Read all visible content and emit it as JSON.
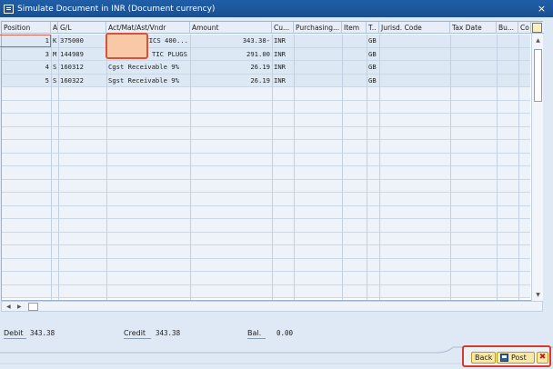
{
  "window": {
    "title": "Simulate Document in INR (Document currency)",
    "close_glyph": "×"
  },
  "columns": [
    {
      "key": "position",
      "label": "Position"
    },
    {
      "key": "a",
      "label": "A"
    },
    {
      "key": "gl",
      "label": "G/L"
    },
    {
      "key": "act",
      "label": "Act/Mat/Ast/Vndr"
    },
    {
      "key": "amount",
      "label": "Amount"
    },
    {
      "key": "cu",
      "label": "Cu..."
    },
    {
      "key": "purchasing",
      "label": "Purchasing..."
    },
    {
      "key": "item",
      "label": "Item"
    },
    {
      "key": "t",
      "label": "T.."
    },
    {
      "key": "jurisd",
      "label": "Jurisd. Code"
    },
    {
      "key": "taxdate",
      "label": "Tax Date"
    },
    {
      "key": "bu",
      "label": "Bu..."
    },
    {
      "key": "co",
      "label": "Co"
    }
  ],
  "rows": [
    {
      "position": "1",
      "a": "K",
      "gl": "375000",
      "act": "TICS 400...",
      "amount": "343.38-",
      "cu": "INR",
      "t": "GB"
    },
    {
      "position": "3",
      "a": "M",
      "gl": "144989",
      "act": "TIC PLUGS",
      "amount": "291.00",
      "cu": "INR",
      "t": "GB"
    },
    {
      "position": "4",
      "a": "S",
      "gl": "160312",
      "act": "Cgst Receivable 9%",
      "amount": "26.19",
      "cu": "INR",
      "t": "GB"
    },
    {
      "position": "5",
      "a": "S",
      "gl": "160322",
      "act": "Sgst Receivable 9%",
      "amount": "26.19",
      "cu": "INR",
      "t": "GB"
    }
  ],
  "totals": {
    "debit_label": "Debit",
    "debit_value": "343.38",
    "credit_label": "Credit",
    "credit_value": "343.38",
    "bal_label": "Bal.",
    "bal_value": "0.00"
  },
  "buttons": {
    "back": "Back",
    "post": "Post",
    "cancel": "✖"
  },
  "icons": {
    "title": "document-icon",
    "save": "save-icon",
    "cancel": "cancel-icon"
  },
  "colors": {
    "title_bar": "#1f5fa8",
    "highlight_border": "#d63b2f",
    "button_fill": "#f7e8a9"
  }
}
